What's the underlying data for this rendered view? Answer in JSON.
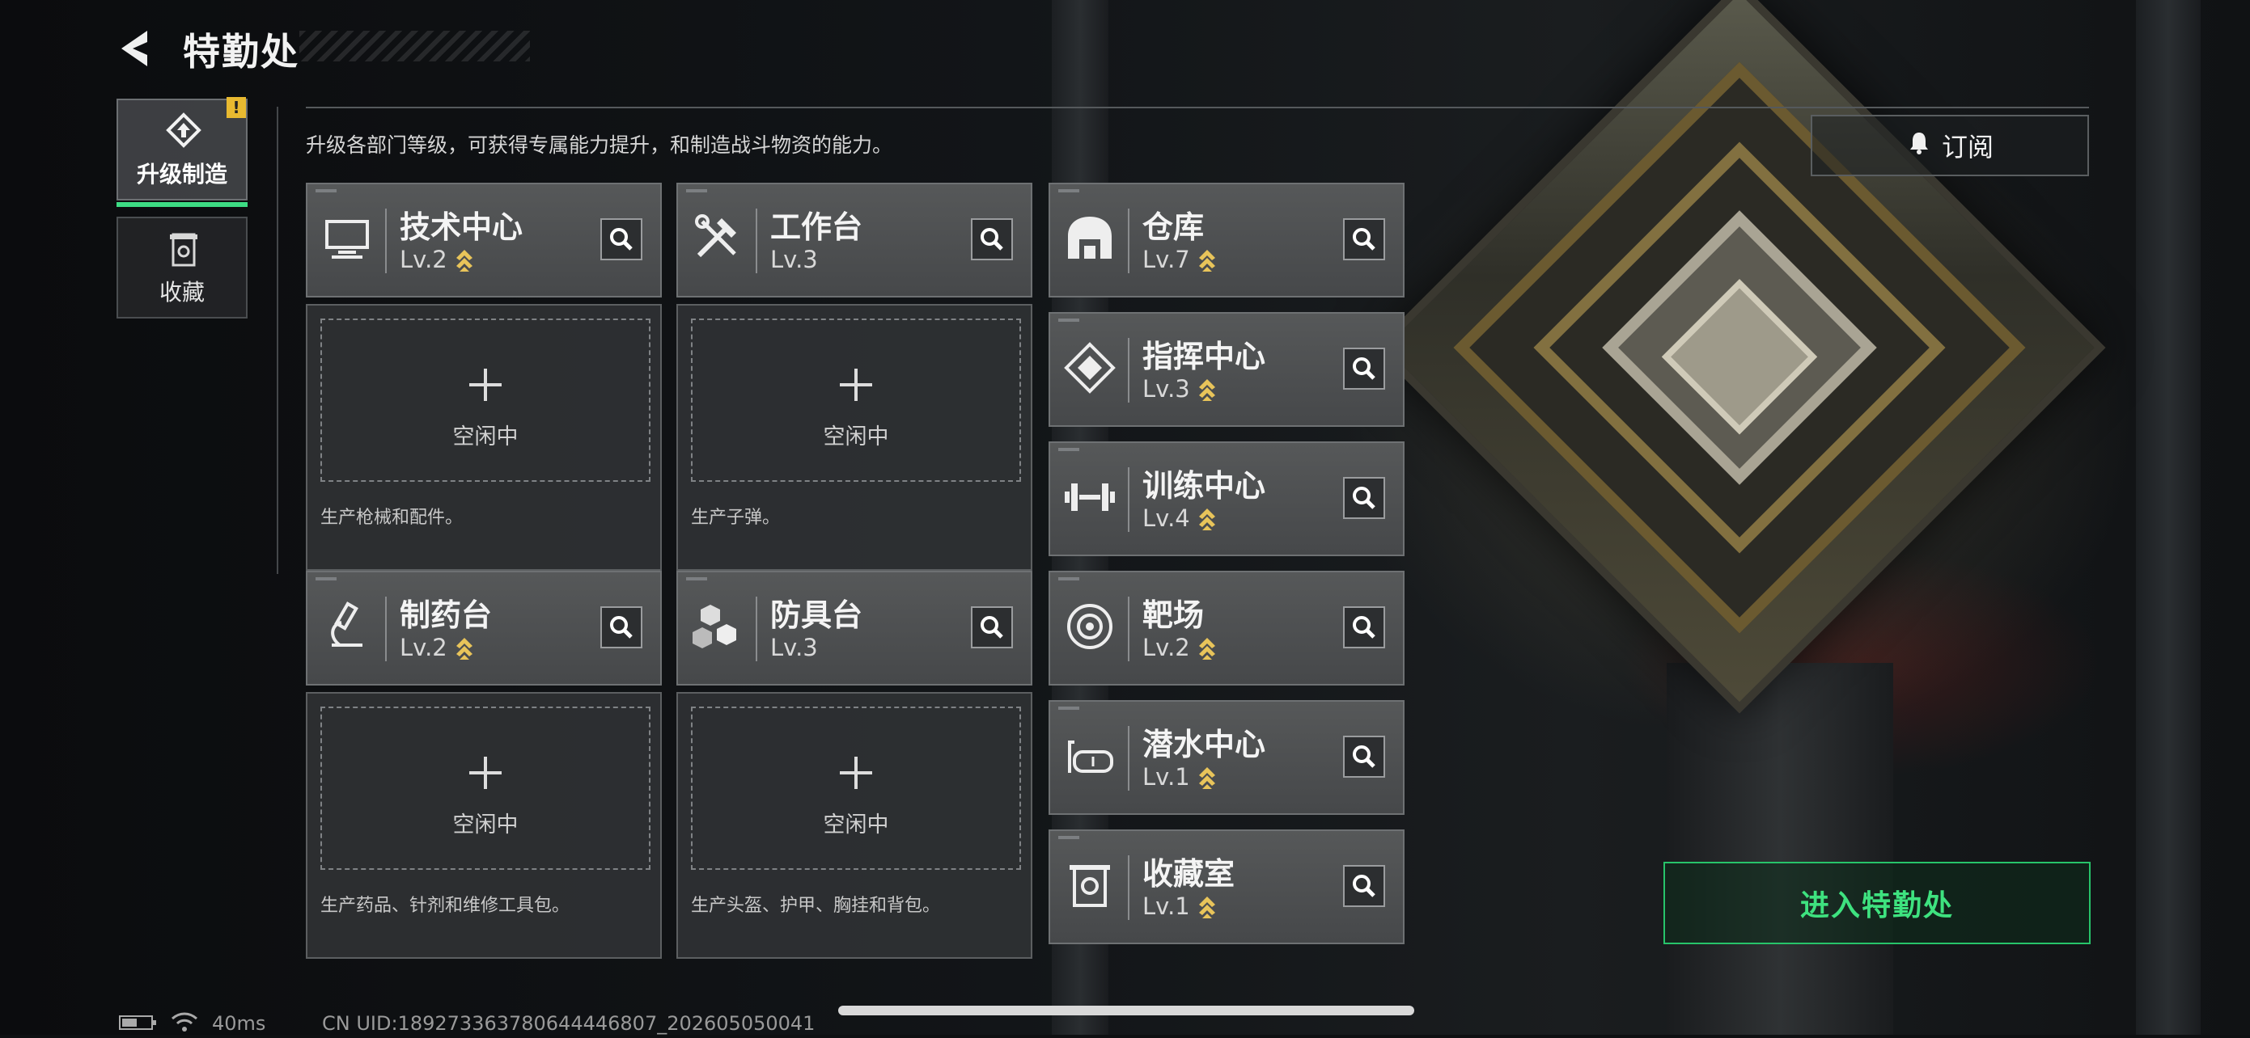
{
  "header": {
    "title": "特勤处"
  },
  "nav": [
    {
      "label": "升级制造",
      "active": true,
      "icon": "upgrade-icon"
    },
    {
      "label": "收藏",
      "active": false,
      "icon": "collection-icon"
    }
  ],
  "nav_warning": "!",
  "description": "升级各部门等级，可获得专属能力提升，和制造战斗物资的能力。",
  "subscribe_label": "订阅",
  "enter_label": "进入特勤处",
  "departments": [
    {
      "name": "技术中心",
      "level": "Lv.2",
      "upgradable": true,
      "icon": "monitor-icon"
    },
    {
      "name": "工作台",
      "level": "Lv.3",
      "upgradable": false,
      "icon": "tools-icon"
    },
    {
      "name": "制药台",
      "level": "Lv.2",
      "upgradable": true,
      "icon": "microscope-icon"
    },
    {
      "name": "防具台",
      "level": "Lv.3",
      "upgradable": false,
      "icon": "crates-icon"
    },
    {
      "name": "仓库",
      "level": "Lv.7",
      "upgradable": true,
      "icon": "warehouse-icon"
    },
    {
      "name": "指挥中心",
      "level": "Lv.3",
      "upgradable": true,
      "icon": "command-icon"
    },
    {
      "name": "训练中心",
      "level": "Lv.4",
      "upgradable": true,
      "icon": "dumbbell-icon"
    },
    {
      "name": "靶场",
      "level": "Lv.2",
      "upgradable": true,
      "icon": "target-icon"
    },
    {
      "name": "潜水中心",
      "level": "Lv.1",
      "upgradable": true,
      "icon": "diving-mask-icon"
    },
    {
      "name": "收藏室",
      "level": "Lv.1",
      "upgradable": true,
      "icon": "collection-room-icon"
    }
  ],
  "production": [
    {
      "status": "空闲中",
      "description": "生产枪械和配件。"
    },
    {
      "status": "空闲中",
      "description": "生产子弹。"
    },
    {
      "status": "空闲中",
      "description": "生产药品、针剂和维修工具包。"
    },
    {
      "status": "空闲中",
      "description": "生产头盔、护甲、胸挂和背包。"
    }
  ],
  "status_bar": {
    "ping": "40ms",
    "uid": "CN UID:18927336378064444680​7_202605050041"
  },
  "colors": {
    "accent": "#3ee27f",
    "level_chevron": "#e8c45a",
    "warning": "#e8b930"
  }
}
